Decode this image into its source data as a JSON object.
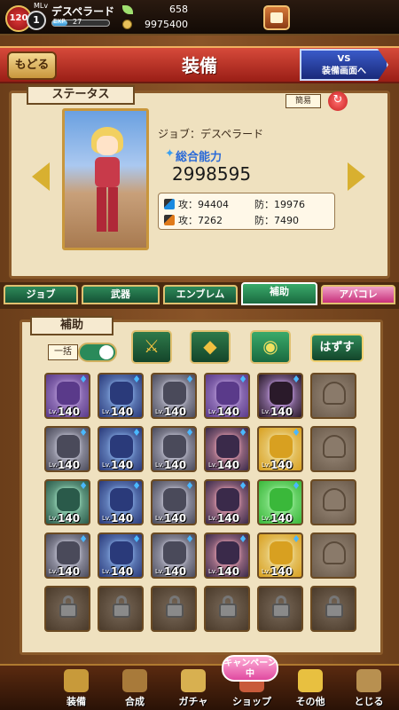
{
  "topbar": {
    "level": "120",
    "mlv_label": "MLv",
    "mlv": "1",
    "player_name": "デスペラード",
    "exp_label": "EXP",
    "exp_value": "27",
    "exp_fraction": 0.27,
    "gems": "658",
    "gold": "9975400"
  },
  "header": {
    "back_label": "もどる",
    "title": "装備",
    "vs_line1": "VS",
    "vs_line2": "装備画面へ"
  },
  "status": {
    "label": "ステータス",
    "simple_label": "簡易",
    "job_text": "ジョブ：デスペラード",
    "total_label": "総合能力",
    "total_value": "2998595",
    "row1_atk": "攻：94404",
    "row1_def": "防：19976",
    "row2_atk": "攻：7262",
    "row2_def": "防：7490"
  },
  "tabs": [
    "ジョブ",
    "武器",
    "エンブレム",
    "補助",
    "アバコレ"
  ],
  "equip": {
    "label": "補助",
    "bulk_label": "一括",
    "remove_label": "はずす",
    "lv_tag": "Lv.",
    "lv_value": "140",
    "grid": [
      [
        "purple",
        "blue",
        "dark",
        "purple",
        "dark-boot",
        "empty"
      ],
      [
        "dark",
        "blue",
        "dark",
        "red",
        "gold",
        "empty"
      ],
      [
        "green",
        "blue",
        "dark",
        "red",
        "green-gold",
        "empty"
      ],
      [
        "dark",
        "blue",
        "dark",
        "red",
        "gold",
        "empty"
      ],
      [
        "locked",
        "locked",
        "locked",
        "locked",
        "locked",
        "locked"
      ]
    ]
  },
  "nav": {
    "campaign": "キャンペーン中",
    "items": [
      "装備",
      "合成",
      "ガチャ",
      "ショップ",
      "その他",
      "とじる"
    ]
  },
  "colors": {
    "header_red": "#c8352a",
    "tab_green": "#1f6b44",
    "tab_pink": "#d84a8a",
    "accent_blue": "#2a6ad8",
    "parchment": "#efe1bf"
  }
}
